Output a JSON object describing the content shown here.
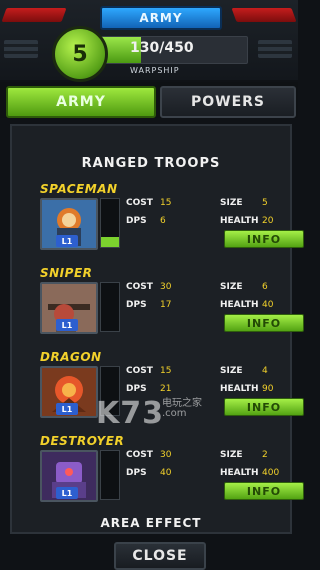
{
  "header": {
    "title": "ARMY",
    "level": "5",
    "xp_text": "130/450",
    "xp_progress": 0.29,
    "subtitle": "WARPSHIP"
  },
  "tabs": [
    {
      "label": "ARMY",
      "active": true
    },
    {
      "label": "POWERS",
      "active": false
    }
  ],
  "section": {
    "title": "RANGED TROOPS",
    "footer": "AREA EFFECT"
  },
  "labels": {
    "cost": "COST",
    "dps": "DPS",
    "size": "SIZE",
    "health": "HEALTH",
    "info": "INFO",
    "level_badge": "L1"
  },
  "troops": [
    {
      "name": "SPACEMAN",
      "cost": "15",
      "dps": "6",
      "size": "5",
      "health": "20",
      "slot_fill": 0.2
    },
    {
      "name": "SNIPER",
      "cost": "30",
      "dps": "17",
      "size": "6",
      "health": "40",
      "slot_fill": 0.0
    },
    {
      "name": "DRAGON",
      "cost": "15",
      "dps": "21",
      "size": "4",
      "health": "90",
      "slot_fill": 0.0
    },
    {
      "name": "DESTROYER",
      "cost": "30",
      "dps": "40",
      "size": "2",
      "health": "400",
      "slot_fill": 0.0
    }
  ],
  "watermark": {
    "main": "K73",
    "sub": "电玩之家",
    "domain": ".com"
  },
  "close_label": "CLOSE",
  "colors": {
    "accent_green": "#7bd12e",
    "name_yellow": "#f2d12b",
    "header_blue": "#2ea8ff",
    "red": "#c51d1d"
  }
}
